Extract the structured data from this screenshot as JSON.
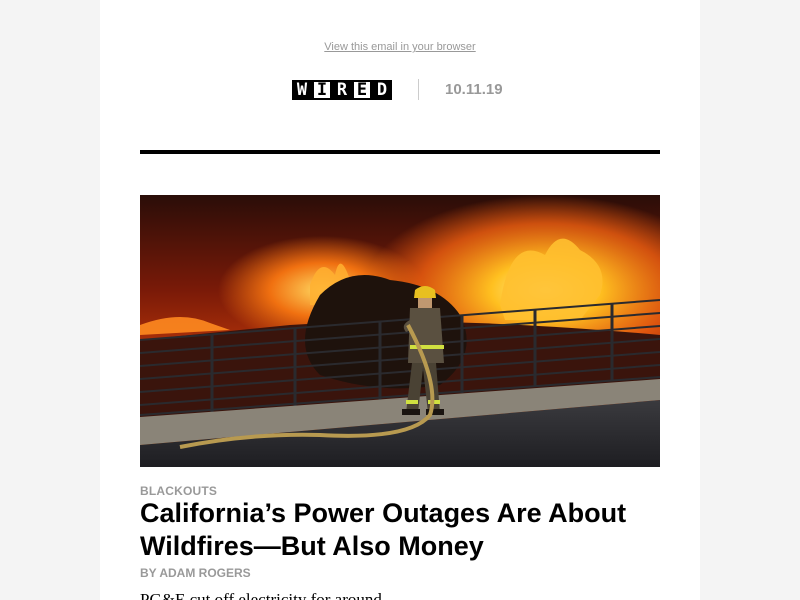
{
  "header": {
    "view_in_browser": "View this email in your browser",
    "logo_letters": [
      "W",
      "I",
      "R",
      "E",
      "D"
    ],
    "date": "10.11.19"
  },
  "article": {
    "kicker": "BLACKOUTS",
    "headline": "California’s Power Outages Are About Wildfires—But Also Money",
    "byline": "BY ADAM ROGERS",
    "body_start": "PG&E cut off electricity for around..."
  },
  "colors": {
    "page_background": "#f4f4f4",
    "email_background": "#ffffff",
    "muted_text": "#999999",
    "rule": "#000000"
  }
}
